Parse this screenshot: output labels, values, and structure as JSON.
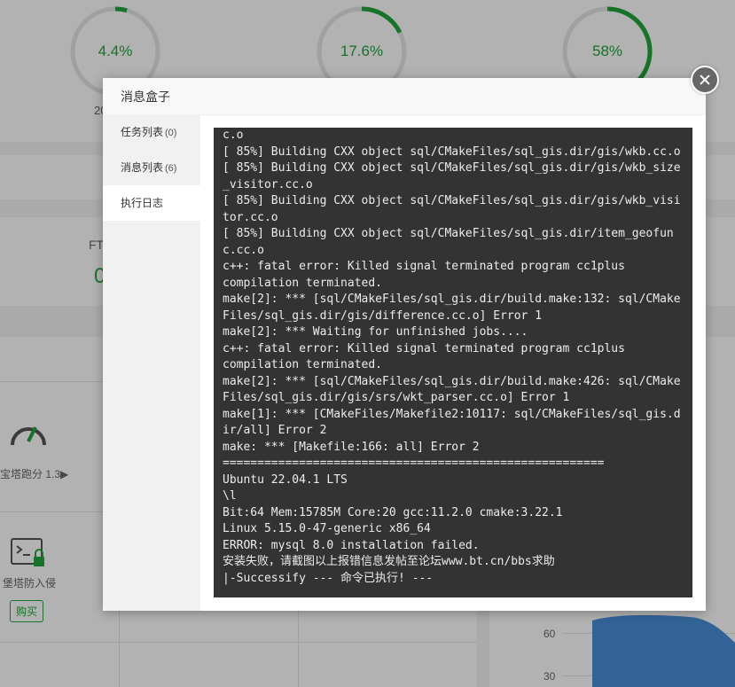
{
  "dashboard": {
    "gauges": [
      {
        "value": "4.4%",
        "fraction": 0.044
      },
      {
        "value": "17.6%",
        "fraction": 0.176
      },
      {
        "value": "58%",
        "fraction": 0.58
      }
    ],
    "partial_20": "20",
    "partial_ft": "FT",
    "partial_zero": "0",
    "score_label": "宝塔跑分 1.3▶",
    "protect_label": "堡塔防入侵",
    "buy_button": "购买",
    "chart_axis": [
      "60",
      "30"
    ]
  },
  "modal": {
    "title": "消息盒子",
    "tabs": [
      {
        "label": "任务列表",
        "count": "(0)"
      },
      {
        "label": "消息列表",
        "count": "(6)"
      },
      {
        "label": "执行日志",
        "count": ""
      }
    ],
    "log_lines": [
      "c.o",
      "[ 85%] Building CXX object sql/CMakeFiles/sql_gis.dir/gis/wkb.cc.o",
      "[ 85%] Building CXX object sql/CMakeFiles/sql_gis.dir/gis/wkb_size",
      "_visitor.cc.o",
      "[ 85%] Building CXX object sql/CMakeFiles/sql_gis.dir/gis/wkb_visi",
      "tor.cc.o",
      "[ 85%] Building CXX object sql/CMakeFiles/sql_gis.dir/item_geofun",
      "c.cc.o",
      "c++: fatal error: Killed signal terminated program cc1plus",
      "compilation terminated.",
      "make[2]: *** [sql/CMakeFiles/sql_gis.dir/build.make:132: sql/CMake",
      "Files/sql_gis.dir/gis/difference.cc.o] Error 1",
      "make[2]: *** Waiting for unfinished jobs....",
      "c++: fatal error: Killed signal terminated program cc1plus",
      "compilation terminated.",
      "make[2]: *** [sql/CMakeFiles/sql_gis.dir/build.make:426: sql/CMake",
      "Files/sql_gis.dir/gis/srs/wkt_parser.cc.o] Error 1",
      "make[1]: *** [CMakeFiles/Makefile2:10117: sql/CMakeFiles/sql_gis.d",
      "ir/all] Error 2",
      "make: *** [Makefile:166: all] Error 2",
      "=======================================================",
      "Ubuntu 22.04.1 LTS",
      "\\l",
      "Bit:64 Mem:15785M Core:20 gcc:11.2.0 cmake:3.22.1",
      "Linux 5.15.0-47-generic x86_64",
      "ERROR: mysql 8.0 installation failed.",
      "安装失败，请截图以上报错信息发帖至论坛www.bt.cn/bbs求助",
      "|-Successify --- 命令已执行! ---"
    ]
  },
  "colors": {
    "accent": "#20a53a",
    "log_bg": "#333333",
    "chart_fill": "#4a90d9"
  }
}
